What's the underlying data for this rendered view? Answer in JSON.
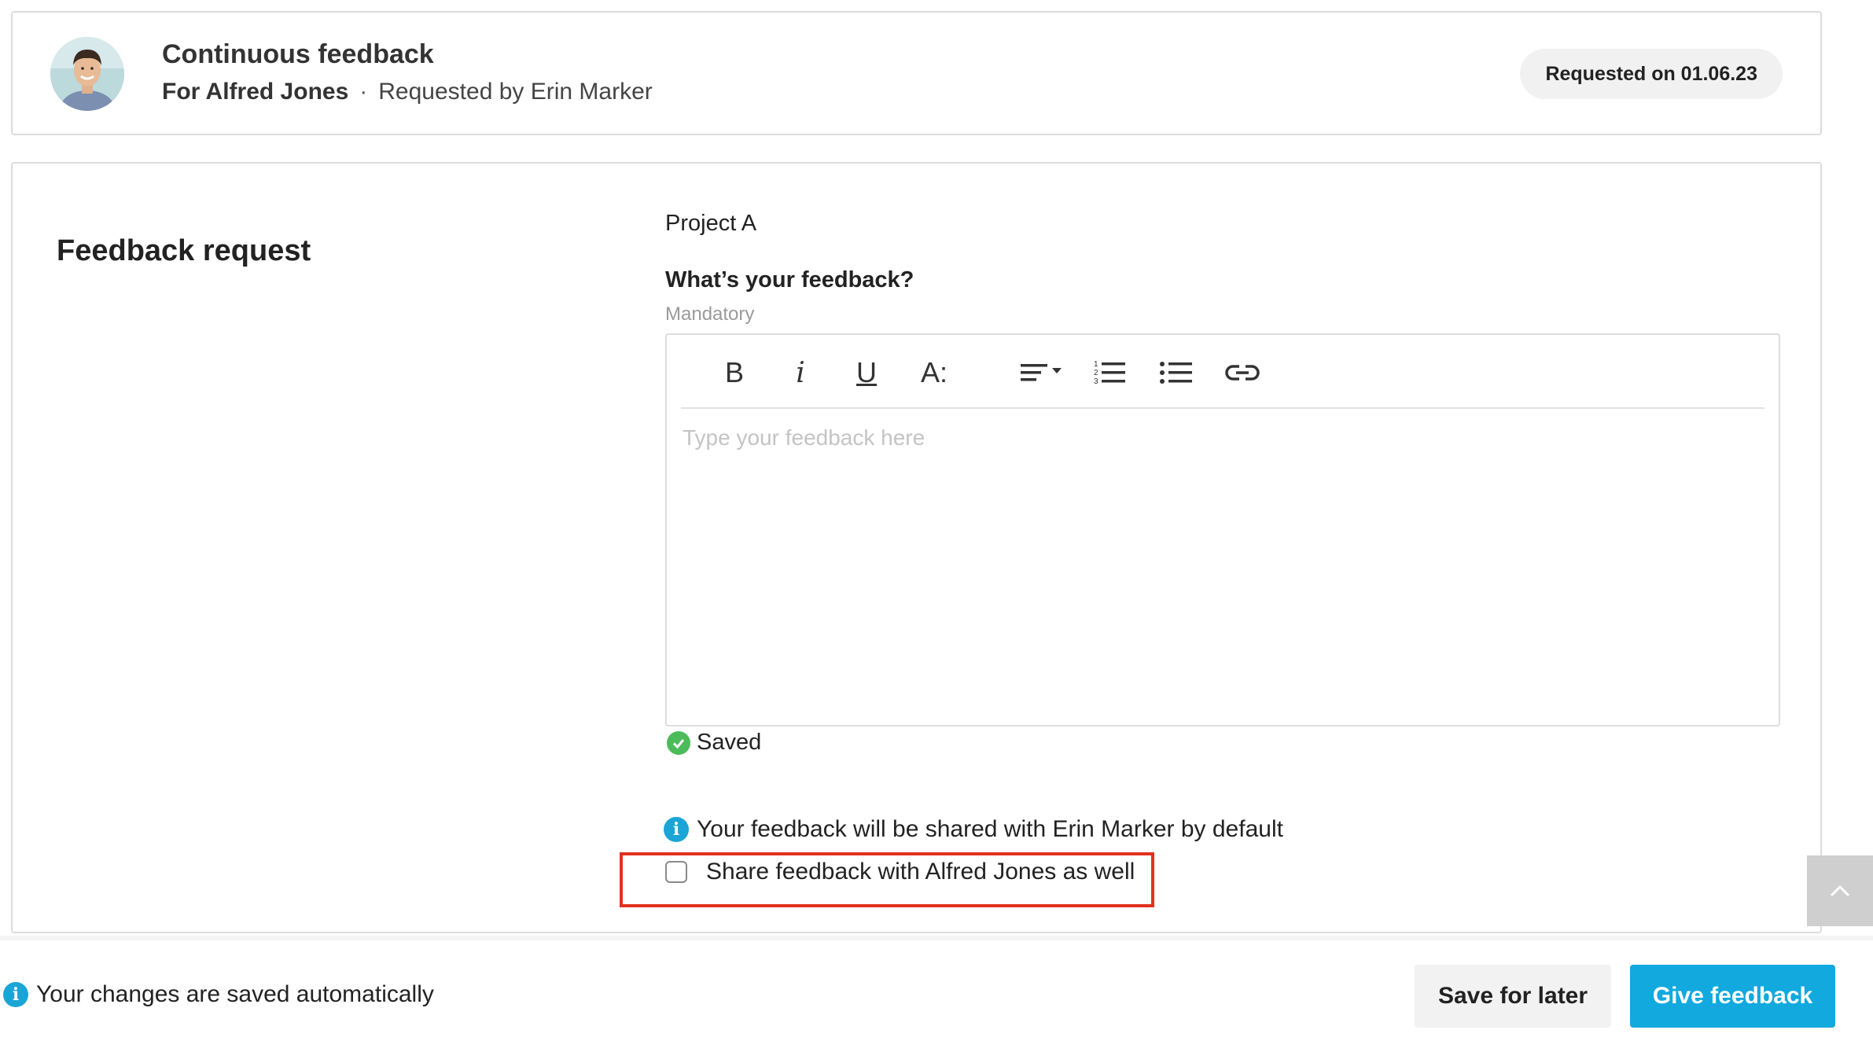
{
  "header": {
    "title": "Continuous feedback",
    "for_label": "For Alfred Jones",
    "separator": "·",
    "requested_by": "Requested by Erin Marker",
    "requested_on": "Requested on 01.06.23"
  },
  "form": {
    "section_title": "Feedback request",
    "project": "Project A",
    "question": "What’s your feedback?",
    "mandatory": "Mandatory",
    "placeholder": "Type your feedback here",
    "toolbar": {
      "bold": "B",
      "italic": "i",
      "underline": "U",
      "font_size": "A:",
      "icons": [
        "align-dropdown-icon",
        "numbered-list-icon",
        "bulleted-list-icon",
        "link-icon"
      ]
    },
    "saved_status": "Saved",
    "share_info": "Your feedback will be shared with Erin Marker by default",
    "share_checkbox_label": "Share feedback with Alfred Jones as well",
    "share_checked": false
  },
  "footer": {
    "note": "Your changes are saved automatically",
    "save_later": "Save for later",
    "give_feedback": "Give feedback"
  },
  "colors": {
    "primary": "#11a9de",
    "info": "#1aa5d6",
    "success": "#4cbb5a",
    "highlight": "#e1311e"
  }
}
